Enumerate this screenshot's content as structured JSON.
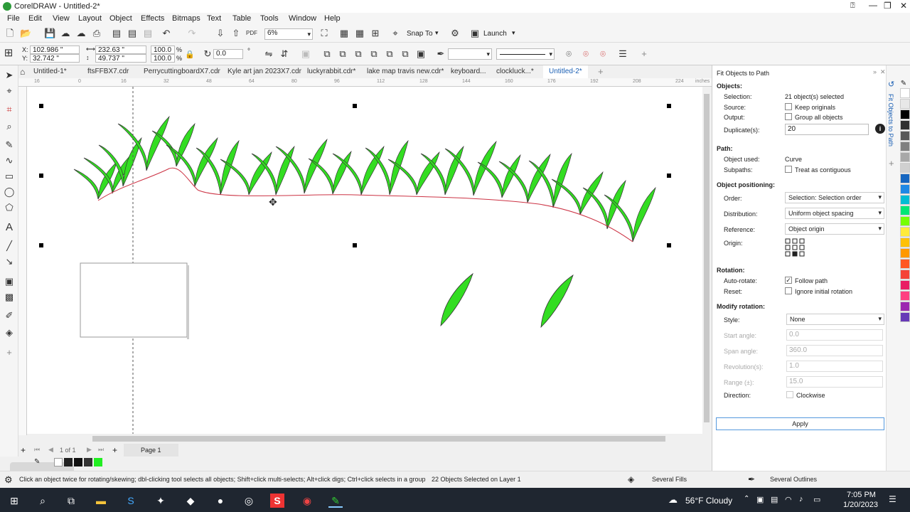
{
  "window": {
    "title": "CorelDRAW - Untitled-2*"
  },
  "menu": [
    "File",
    "Edit",
    "View",
    "Layout",
    "Object",
    "Effects",
    "Bitmaps",
    "Text",
    "Table",
    "Tools",
    "Window",
    "Help"
  ],
  "toolbar": {
    "zoom": "6%",
    "snap_to": "Snap To",
    "launch": "Launch"
  },
  "props": {
    "x": "102.986 \"",
    "y": "32.742 \"",
    "w": "232.63 \"",
    "h": "49.737 \"",
    "sx": "100.0",
    "sy": "100.0",
    "pct": "%",
    "angle": "0.0"
  },
  "tabs": [
    "Untitled-1*",
    "ftsFFBX7.cdr",
    "PerrycuttingboardX7.cdr",
    "Kyle art jan 2023X7.cdr",
    "luckyrabbit.cdr*",
    "lake map travis new.cdr*",
    "keyboard...",
    "clockluck...*",
    "Untitled-2*"
  ],
  "ruler": {
    "ticks": [
      "16",
      "0",
      "16",
      "32",
      "48",
      "64",
      "80",
      "96",
      "112",
      "128",
      "144",
      "160",
      "176",
      "192",
      "208",
      "224"
    ],
    "unit": "inches"
  },
  "page": {
    "counter": "1 of 1",
    "name": "Page 1"
  },
  "status": {
    "hint": "Click an object twice for rotating/skewing; dbl-clicking tool selects all objects; Shift+click multi-selects; Alt+click digs; Ctrl+click selects in a group",
    "selection": "22 Objects Selected on Layer 1",
    "fill": "Several Fills",
    "outline": "Several Outlines"
  },
  "docker": {
    "title": "Fit Objects to Path",
    "tab_label": "Fit Objects to Path",
    "objects_h": "Objects:",
    "selection_l": "Selection:",
    "selection_v": "21 object(s) selected",
    "source_l": "Source:",
    "keep_originals": "Keep originals",
    "output_l": "Output:",
    "group_all": "Group all objects",
    "duplicate_l": "Duplicate(s):",
    "duplicate_v": "20",
    "path_h": "Path:",
    "object_used_l": "Object used:",
    "object_used_v": "Curve",
    "subpaths_l": "Subpaths:",
    "contiguous": "Treat as contiguous",
    "positioning_h": "Object positioning:",
    "order_l": "Order:",
    "order_v": "Selection: Selection order",
    "distribution_l": "Distribution:",
    "distribution_v": "Uniform object spacing",
    "reference_l": "Reference:",
    "reference_v": "Object origin",
    "origin_l": "Origin:",
    "rotation_h": "Rotation:",
    "autorotate_l": "Auto-rotate:",
    "follow_path": "Follow path",
    "reset_l": "Reset:",
    "ignore_rotation": "Ignore initial rotation",
    "modify_h": "Modify rotation:",
    "style_l": "Style:",
    "style_v": "None",
    "start_l": "Start angle:",
    "start_v": "0.0",
    "span_l": "Span angle:",
    "span_v": "360.0",
    "rev_l": "Revolution(s):",
    "rev_v": "1.0",
    "range_l": "Range (±):",
    "range_v": "15.0",
    "direction_l": "Direction:",
    "clockwise": "Clockwise",
    "apply": "Apply"
  },
  "taskbar": {
    "weather": "56°F Cloudy",
    "time": "7:05 PM",
    "date": "1/20/2023"
  },
  "colors": {
    "leaf": "#33dd22",
    "path": "#cc3344",
    "accent": "#1a5fb4",
    "apply_border": "#5599dd"
  },
  "palette": [
    "#ffffff",
    "#e8e8e8",
    "#000000",
    "#303030",
    "#585858",
    "#808080",
    "#a8a8a8",
    "#d0d0d0",
    "#1565c0",
    "#1e88e5",
    "#00bcd4",
    "#00e676",
    "#76ff03",
    "#ffeb3b",
    "#ffc107",
    "#ff9800",
    "#ff5722",
    "#f44336",
    "#e91e63",
    "#ff4081",
    "#9c27b0",
    "#673ab7"
  ]
}
